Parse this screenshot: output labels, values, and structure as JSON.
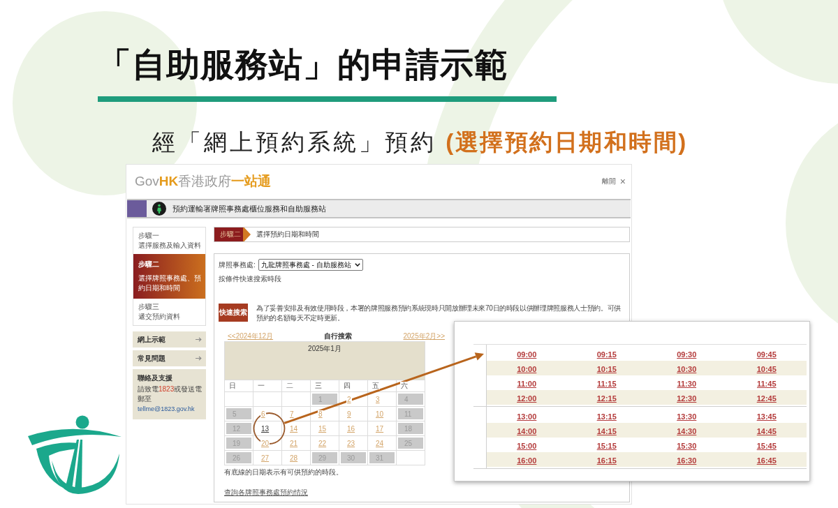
{
  "slide": {
    "title": "「自助服務站」的申請示範",
    "subtitle": "經「網上預約系統」預約 **(選擇預約日期和時間)**"
  },
  "site_header": {
    "logo": {
      "gov": "Gov",
      "hk": "HK",
      "name": "香港政府",
      "brand": "一站通"
    },
    "exit": "離開",
    "close": "×"
  },
  "banner": {
    "title": "預約運輸署牌照事務處櫃位服務和自助服務站"
  },
  "steps": [
    {
      "step": "步驟一",
      "label": "選擇服務及輸入資料",
      "selected": false
    },
    {
      "step": "步驟二",
      "label": "選擇牌照事務處、預約日期和時間",
      "selected": true
    },
    {
      "step": "步驟三",
      "label": "遞交預約資料",
      "selected": false
    }
  ],
  "side_links": [
    {
      "label": "網上示範"
    },
    {
      "label": "常見問題"
    }
  ],
  "contact": {
    "title": "聯絡及支援",
    "before": "請致電",
    "phone": "1823",
    "middle": "或發送電郵至",
    "email": "tellme@1823.gov.hk"
  },
  "step_header": {
    "step": "步驟二",
    "title": "選擇預約日期和時間"
  },
  "office_field": {
    "label": "牌照事務處:",
    "value": "九龍牌照事務處 - 自助服務站"
  },
  "quick_search": {
    "heading": "按條件快速搜索時段",
    "badge": "快速搜索",
    "notice": "為了妥善安排及有效使用時段，本署的牌照服務預約系統現時只開放辦理未來70日的時段以供辦理牌照服務人士預約。可供預約的名額每天不定時更新。"
  },
  "calendar": {
    "prev": "<<2024年12月",
    "mode": "自行搜索",
    "next": "2025年2月>>",
    "month": "2025年1月",
    "weekdays": [
      "日",
      "一",
      "二",
      "三",
      "四",
      "五",
      "六"
    ],
    "weeks": [
      [
        {
          "kind": "empty"
        },
        {
          "kind": "empty"
        },
        {
          "kind": "empty"
        },
        {
          "kind": "day",
          "day": "1",
          "disabled": true,
          "selected": false
        },
        {
          "kind": "day",
          "day": "2",
          "disabled": false,
          "selected": false
        },
        {
          "kind": "day",
          "day": "3",
          "disabled": false,
          "selected": false
        },
        {
          "kind": "day",
          "day": "4",
          "disabled": true,
          "selected": false
        }
      ],
      [
        {
          "kind": "day",
          "day": "5",
          "disabled": true,
          "selected": false
        },
        {
          "kind": "day",
          "day": "6",
          "disabled": false,
          "selected": false
        },
        {
          "kind": "day",
          "day": "7",
          "disabled": false,
          "selected": false
        },
        {
          "kind": "day",
          "day": "8",
          "disabled": false,
          "selected": false
        },
        {
          "kind": "day",
          "day": "9",
          "disabled": false,
          "selected": false
        },
        {
          "kind": "day",
          "day": "10",
          "disabled": false,
          "selected": false
        },
        {
          "kind": "day",
          "day": "11",
          "disabled": true,
          "selected": false
        }
      ],
      [
        {
          "kind": "day",
          "day": "12",
          "disabled": true,
          "selected": false
        },
        {
          "kind": "day",
          "day": "13",
          "disabled": false,
          "selected": true
        },
        {
          "kind": "day",
          "day": "14",
          "disabled": false,
          "selected": false
        },
        {
          "kind": "day",
          "day": "15",
          "disabled": false,
          "selected": false
        },
        {
          "kind": "day",
          "day": "16",
          "disabled": false,
          "selected": false
        },
        {
          "kind": "day",
          "day": "17",
          "disabled": false,
          "selected": false
        },
        {
          "kind": "day",
          "day": "18",
          "disabled": true,
          "selected": false
        }
      ],
      [
        {
          "kind": "day",
          "day": "19",
          "disabled": true,
          "selected": false
        },
        {
          "kind": "day",
          "day": "20",
          "disabled": false,
          "selected": false
        },
        {
          "kind": "day",
          "day": "21",
          "disabled": false,
          "selected": false
        },
        {
          "kind": "day",
          "day": "22",
          "disabled": false,
          "selected": false
        },
        {
          "kind": "day",
          "day": "23",
          "disabled": false,
          "selected": false
        },
        {
          "kind": "day",
          "day": "24",
          "disabled": false,
          "selected": false
        },
        {
          "kind": "day",
          "day": "25",
          "disabled": true,
          "selected": false
        }
      ],
      [
        {
          "kind": "day",
          "day": "26",
          "disabled": true,
          "selected": false
        },
        {
          "kind": "day",
          "day": "27",
          "disabled": false,
          "selected": false
        },
        {
          "kind": "day",
          "day": "28",
          "disabled": false,
          "selected": false
        },
        {
          "kind": "day",
          "day": "29",
          "disabled": true,
          "selected": false
        },
        {
          "kind": "day",
          "day": "30",
          "disabled": true,
          "selected": false
        },
        {
          "kind": "day",
          "day": "31",
          "disabled": true,
          "selected": false
        },
        {
          "kind": "empty"
        }
      ]
    ],
    "note": "有底線的日期表示有可供預約的時段。",
    "status_link": "查詢各牌照事務處預約情況"
  },
  "time_slots": {
    "groups": [
      {
        "rows": [
          [
            "09:00",
            "09:15",
            "09:30",
            "09:45"
          ],
          [
            "10:00",
            "10:15",
            "10:30",
            "10:45"
          ],
          [
            "11:00",
            "11:15",
            "11:30",
            "11:45"
          ],
          [
            "12:00",
            "12:15",
            "12:30",
            "12:45"
          ]
        ]
      },
      {
        "rows": [
          [
            "13:00",
            "13:15",
            "13:30",
            "13:45"
          ],
          [
            "14:00",
            "14:15",
            "14:30",
            "14:45"
          ],
          [
            "15:00",
            "15:15",
            "15:30",
            "15:45"
          ],
          [
            "16:00",
            "16:15",
            "16:30",
            "16:45"
          ]
        ]
      }
    ]
  }
}
